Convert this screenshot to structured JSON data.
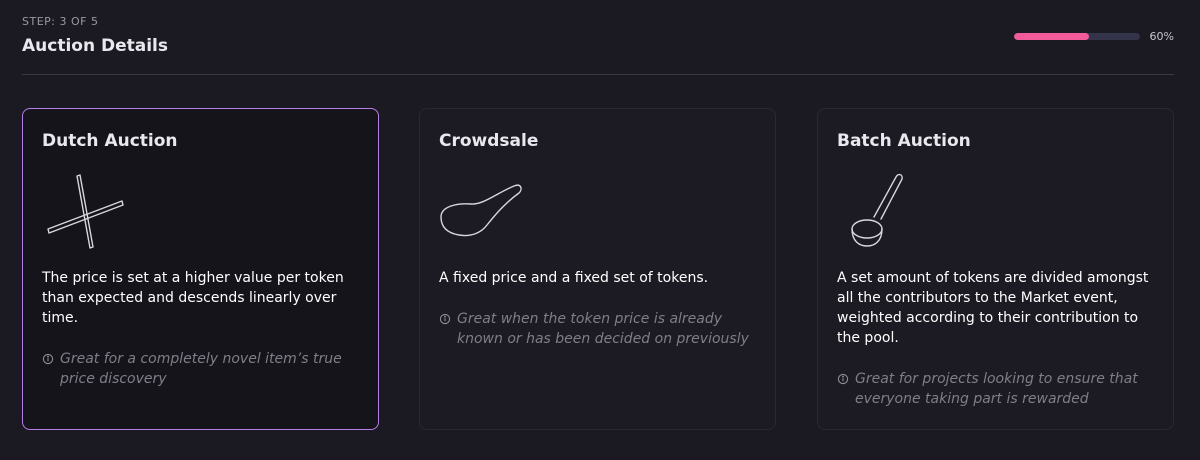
{
  "header": {
    "step": "STEP: 3 OF 5",
    "title": "Auction Details",
    "progress_value": 0.6,
    "progress_text": "60%"
  },
  "colors": {
    "background": "#1b1a22",
    "card_border": "#2a2933",
    "selected_border": "#b57ee8",
    "progress_fill": "#f25a9a",
    "progress_track": "#33334a",
    "muted_text": "#7f7e88"
  },
  "cards": [
    {
      "title": "Dutch Auction",
      "icon": "chopsticks-icon",
      "description": "The price is set at a higher value per token than expected and descends linearly over time.",
      "hint": "Great for a completely novel item’s true price discovery",
      "selected": true
    },
    {
      "title": "Crowdsale",
      "icon": "soup-spoon-icon",
      "description": "A fixed price and a fixed set of tokens.",
      "hint": "Great when the token price is already known or has been decided on previously",
      "selected": false
    },
    {
      "title": "Batch Auction",
      "icon": "ladle-icon",
      "description": "A set amount of tokens are divided amongst all the contributors to the Market event, weighted according to their contribution to the pool.",
      "hint": "Great for projects looking to ensure that everyone taking part is rewarded",
      "selected": false
    }
  ]
}
